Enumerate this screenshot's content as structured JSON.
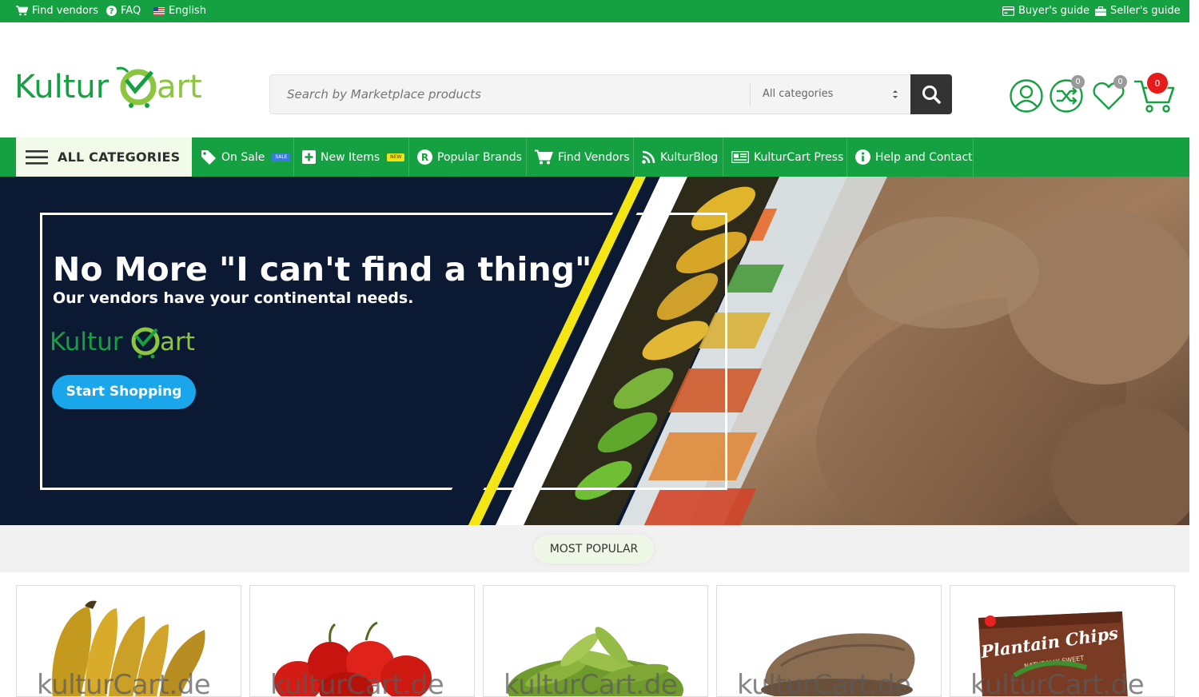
{
  "topbar": {
    "find_vendors": "Find vendors",
    "faq": "FAQ",
    "language": "English",
    "buyers_guide": "Buyer's guide",
    "sellers_guide": "Seller's guide"
  },
  "brand": {
    "logo_text_1": "Kultur",
    "logo_text_2": "art",
    "primary_color": "#15a041",
    "logo_green": "#8cc63f"
  },
  "search": {
    "placeholder": "Search by Marketplace products",
    "category_selected": "All categories"
  },
  "header_icons": {
    "account": "user-icon",
    "compare_count": "0",
    "wishlist_count": "0",
    "cart_count": "0"
  },
  "nav": {
    "all_categories": "ALL CATEGORIES",
    "items": [
      {
        "label": "On Sale",
        "tag": "SALE",
        "icon": "tag-icon"
      },
      {
        "label": "New Items",
        "tag": "NEW",
        "icon": "plus-square-icon"
      },
      {
        "label": "Popular Brands",
        "icon": "registered-icon"
      },
      {
        "label": "Find Vendors",
        "icon": "cart-icon"
      },
      {
        "label": "KulturBlog",
        "icon": "rss-icon"
      },
      {
        "label": "KulturCart Press",
        "icon": "newspaper-icon"
      },
      {
        "label": "Help and Contact",
        "icon": "info-icon"
      }
    ]
  },
  "hero": {
    "title": "No More \"I can't find a thing\"",
    "subtitle": "Our vendors have your continental needs.",
    "cta": "Start Shopping"
  },
  "popular": {
    "label": "MOST POPULAR",
    "watermark": "kulturCart.de",
    "products": [
      {
        "name": "plantain-product"
      },
      {
        "name": "pepper-product"
      },
      {
        "name": "okra-product"
      },
      {
        "name": "yam-product"
      },
      {
        "name": "plantain-chips-product",
        "package_text": "Plantain Chips",
        "package_sub": "NATURALLY SWEET"
      }
    ]
  }
}
